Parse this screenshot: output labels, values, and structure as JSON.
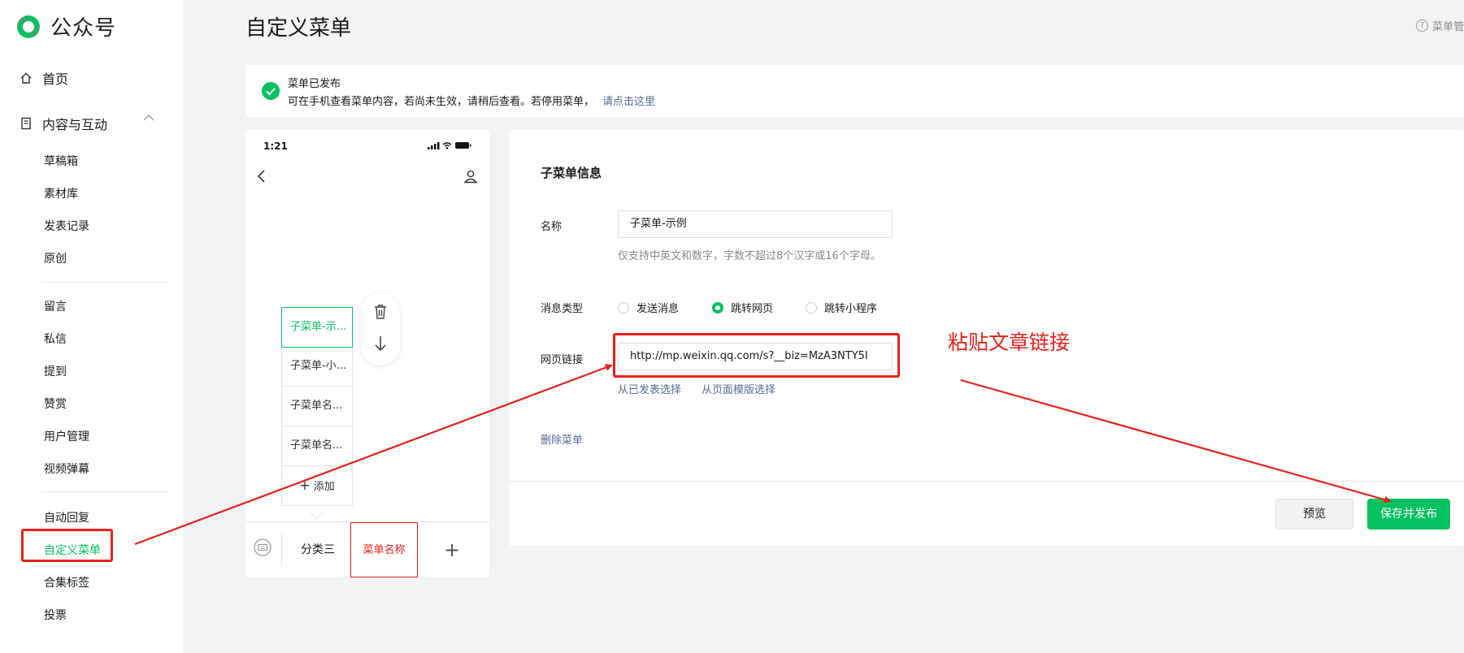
{
  "sidebar": {
    "brand": "公众号",
    "home": "首页",
    "section_content": "内容与互动",
    "items": [
      {
        "label": "草稿箱"
      },
      {
        "label": "素材库"
      },
      {
        "label": "发表记录"
      },
      {
        "label": "原创"
      },
      {
        "label": "留言"
      },
      {
        "label": "私信"
      },
      {
        "label": "提到"
      },
      {
        "label": "赞赏"
      },
      {
        "label": "用户管理"
      },
      {
        "label": "视频弹幕"
      },
      {
        "label": "自动回复"
      },
      {
        "label": "自定义菜单"
      },
      {
        "label": "合集标签"
      },
      {
        "label": "投票"
      }
    ]
  },
  "header": {
    "title": "自定义菜单",
    "help": "菜单管"
  },
  "notice": {
    "title": "菜单已发布",
    "desc": "可在手机查看菜单内容，若尚未生效，请稍后查看。若停用菜单，",
    "link": "请点击这里"
  },
  "phone": {
    "time": "1:21",
    "submenus": [
      {
        "label": "子菜单-示..."
      },
      {
        "label": "子菜单-小..."
      },
      {
        "label": "子菜单名..."
      },
      {
        "label": "子菜单名..."
      }
    ],
    "add_label": "添加",
    "menu_items": [
      {
        "label": "分类三"
      },
      {
        "label": "菜单名称"
      }
    ],
    "plus": "+"
  },
  "panel": {
    "title": "子菜单信息",
    "name_label": "名称",
    "name_value": "子菜单-示例",
    "name_hint": "仅支持中英文和数字，字数不超过8个汉字或16个字母。",
    "type_label": "消息类型",
    "type_options": [
      {
        "label": "发送消息"
      },
      {
        "label": "跳转网页"
      },
      {
        "label": "跳转小程序"
      }
    ],
    "type_selected": "跳转网页",
    "url_label": "网页链接",
    "url_value": "http://mp.weixin.qq.com/s?__biz=MzA3NTY5I",
    "pick_published": "从已发表选择",
    "pick_template": "从页面模版选择",
    "delete_menu": "删除菜单",
    "btn_preview": "预览",
    "btn_save": "保存并发布"
  },
  "annotation": "粘贴文章链接",
  "colors": {
    "brand_green": "#07c160",
    "link_blue": "#576b95",
    "annotation_red": "#e8201a"
  }
}
